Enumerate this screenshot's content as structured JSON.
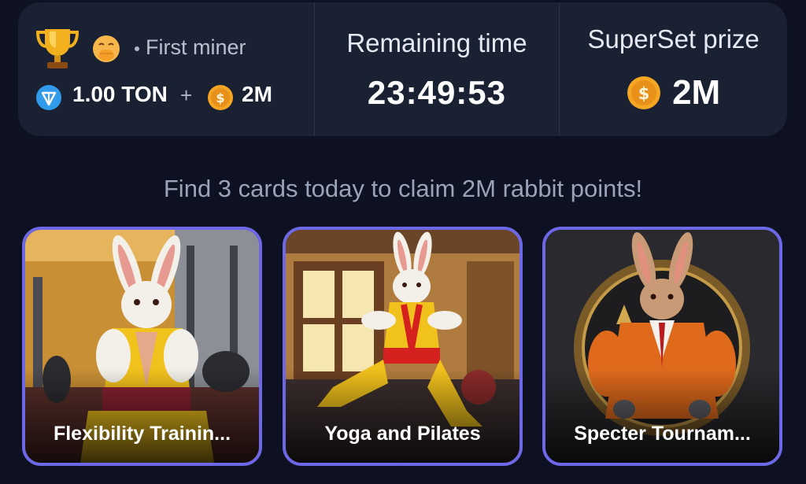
{
  "stats": {
    "first_miner": {
      "label": "First miner",
      "ton_amount": "1.00 TON",
      "plus": "+",
      "coin_amount": "2M"
    },
    "remaining": {
      "title": "Remaining time",
      "time": "23:49:53"
    },
    "prize": {
      "title": "SuperSet prize",
      "amount": "2M"
    }
  },
  "subtitle": "Find 3 cards today to claim 2M rabbit points!",
  "cards": [
    {
      "label": "Flexibility Trainin...",
      "scene": "gym"
    },
    {
      "label": "Yoga and Pilates",
      "scene": "room"
    },
    {
      "label": "Specter Tournam...",
      "scene": "medallion"
    }
  ],
  "colors": {
    "background": "#0d1121",
    "panel": "#1a2133",
    "card_border": "#6d68e8",
    "coin": "#f5a623",
    "ton": "#2f9bea"
  },
  "icons": [
    "trophy-icon",
    "hand-over-mouth-emoji-icon",
    "ton-icon",
    "coin-icon"
  ]
}
